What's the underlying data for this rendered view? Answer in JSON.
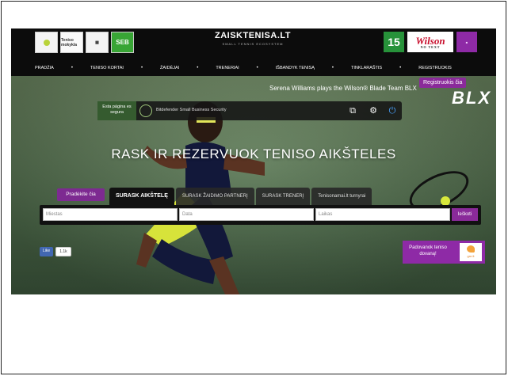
{
  "header": {
    "brand_title": "ZAISKTENISA.LT",
    "brand_subtitle": "SMALL TENNIS ECOSYSTEM",
    "sponsors_left": [
      "Teniso mokykla",
      "SEB"
    ],
    "sponsors_right": [
      "15",
      "Wilson"
    ],
    "nav": [
      "PRADŽIA",
      "TENISO KORTAI",
      "ŽAIDĖJAI",
      "TRENERIAI",
      "IŠBANDYK TENISĄ",
      "TINKLARAŠTIS",
      "REGISTRUOKIS"
    ]
  },
  "hero": {
    "promo_text": "Serena Williams plays the Wilson® Blade Team BLX",
    "promo_logo": "BLX",
    "register_tooltip": "Registruokis čia",
    "headline": "RASK IR REZERVUOK TENISO AIKŠTELES",
    "start_button": "Pradėkite čia"
  },
  "bitdefender": {
    "badge": "Esta página es segura",
    "text": "Bitdefender Small Business Security"
  },
  "tabs": [
    {
      "label": "SURASK AIKŠTELĘ",
      "active": true
    },
    {
      "label": "SURASK ŽAIDIMO PARTNERĮ",
      "active": false
    },
    {
      "label": "SURASK TRENERĮ",
      "active": false
    },
    {
      "label": "Tenisonamai.lt turnyrai",
      "active": false
    }
  ],
  "search": {
    "city_placeholder": "Miestas",
    "date_placeholder": "Data",
    "time_placeholder": "Laikas",
    "submit_label": "Ieškoti"
  },
  "facebook": {
    "like": "Like",
    "count": "1.1k"
  },
  "gift": {
    "text": "Padovanok teniso dovaną!",
    "logo": "gre.lt"
  },
  "colors": {
    "accent": "#8a2a9a",
    "header_bg": "#0c0c0c",
    "court": "#5d7a57"
  }
}
